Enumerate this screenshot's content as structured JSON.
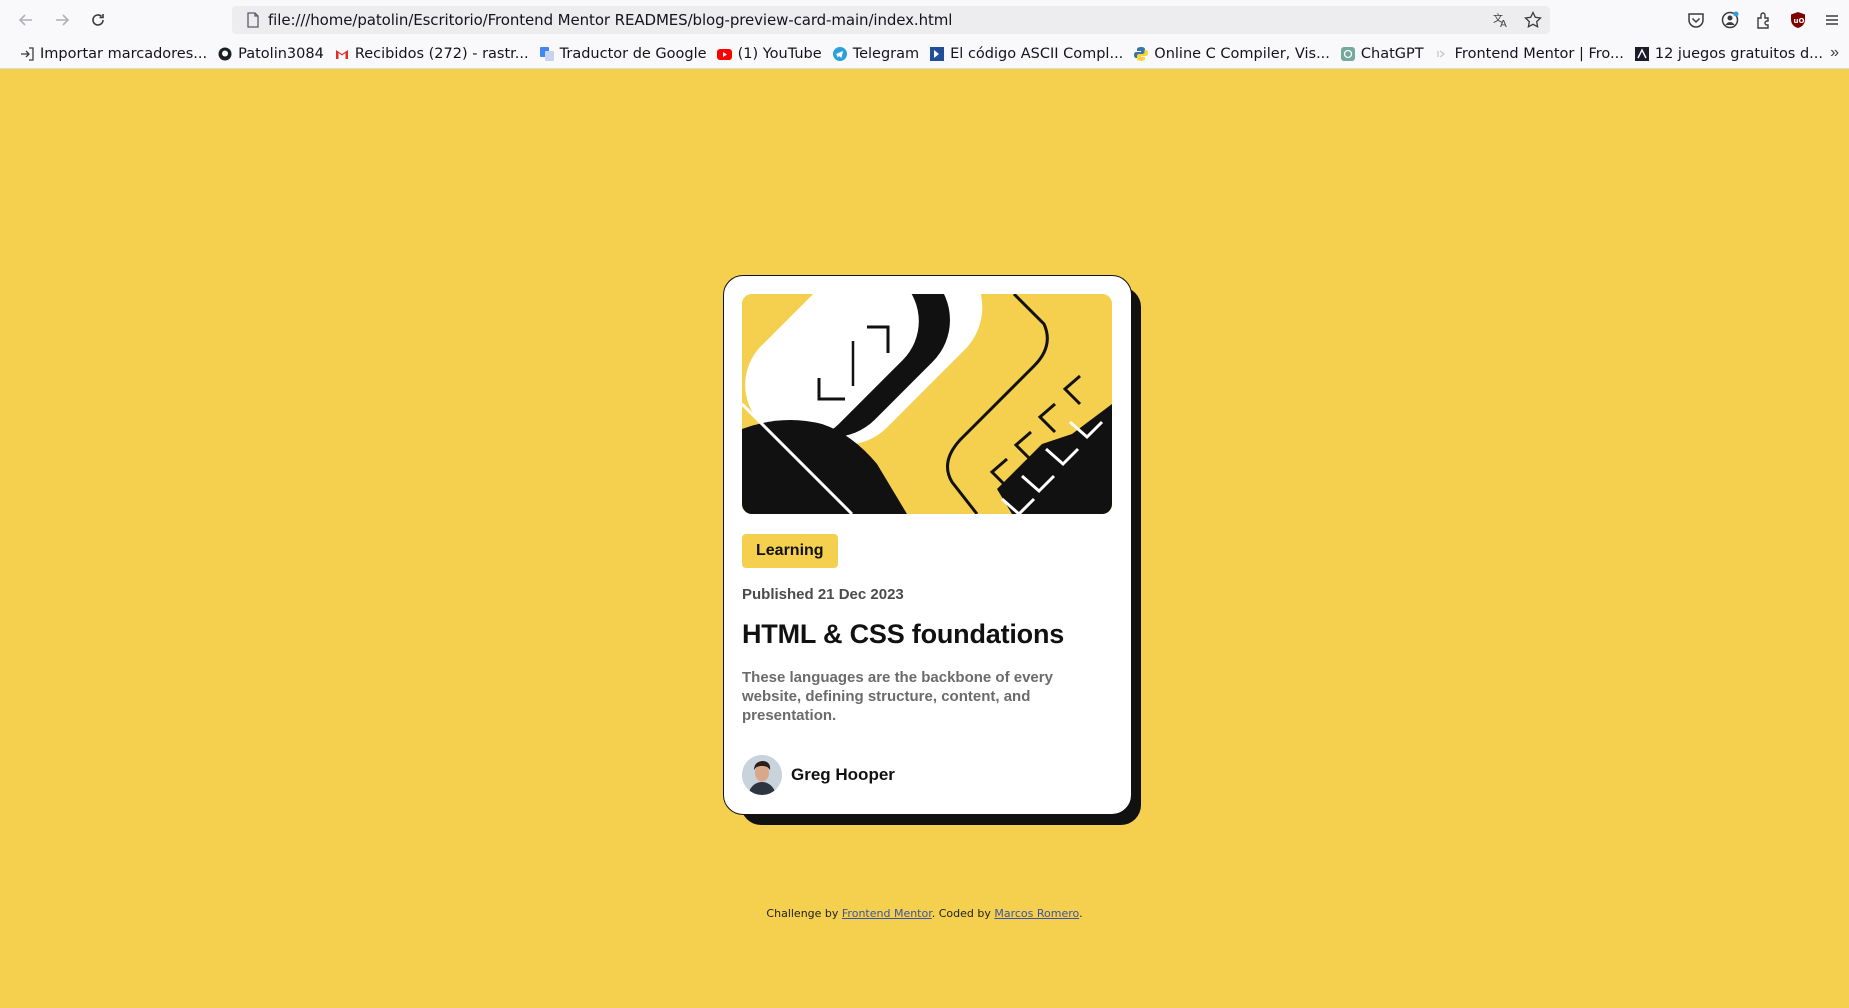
{
  "browser": {
    "url": "file:///home/patolin/Escritorio/Frontend Mentor READMES/blog-preview-card-main/index.html",
    "bookmarks": [
      {
        "label": "Importar marcadores...",
        "icon": "import-icon"
      },
      {
        "label": "Patolin3084",
        "icon": "github-icon"
      },
      {
        "label": "Recibidos (272) - rastr...",
        "icon": "gmail-icon"
      },
      {
        "label": "Traductor de Google",
        "icon": "translate-icon"
      },
      {
        "label": "(1) YouTube",
        "icon": "youtube-icon"
      },
      {
        "label": "Telegram",
        "icon": "telegram-icon"
      },
      {
        "label": "El código ASCII Compl...",
        "icon": "ascii-icon"
      },
      {
        "label": "Online C Compiler, Vis...",
        "icon": "python-icon"
      },
      {
        "label": "ChatGPT",
        "icon": "chatgpt-icon"
      },
      {
        "label": "Frontend Mentor | Fro...",
        "icon": "frontend-mentor-icon"
      },
      {
        "label": "12 juegos gratuitos d...",
        "icon": "games-icon"
      }
    ]
  },
  "card": {
    "tag": "Learning",
    "published": "Published 21 Dec 2023",
    "title": "HTML & CSS foundations",
    "description": "These languages are the backbone of every website, defining structure, content, and presentation.",
    "author": "Greg Hooper"
  },
  "attribution": {
    "prefix": "Challenge by ",
    "link1": "Frontend Mentor",
    "middle": ". Coded by ",
    "link2": "Marcos Romero",
    "suffix": "."
  },
  "colors": {
    "background": "#f4d04e",
    "card": "#ffffff",
    "ink": "#111111"
  }
}
